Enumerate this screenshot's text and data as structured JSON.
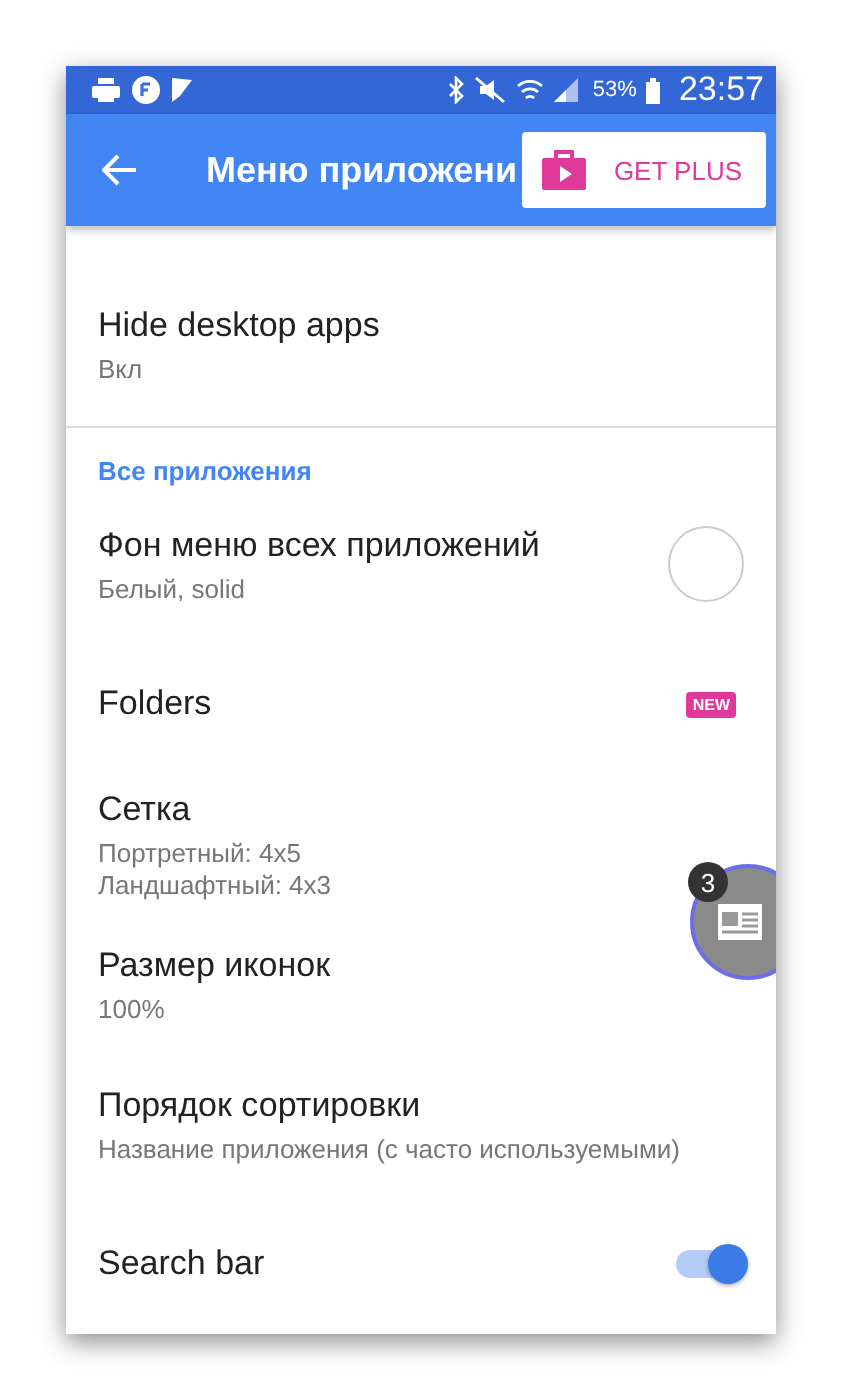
{
  "status_bar": {
    "battery": "53%",
    "time": "23:57"
  },
  "app_bar": {
    "title": "Меню приложени",
    "plus_button": "GET PLUS"
  },
  "rows": [
    {
      "kind": "text",
      "title": "Hide desktop apps",
      "subtitle": [
        "Вкл"
      ]
    },
    {
      "kind": "section",
      "title": "Все приложения"
    },
    {
      "kind": "color",
      "title": "Фон меню всех приложений",
      "subtitle": [
        "Белый, solid"
      ],
      "color": "#ffffff"
    },
    {
      "kind": "badge",
      "title": "Folders",
      "badge": "NEW"
    },
    {
      "kind": "text",
      "title": "Сетка",
      "subtitle": [
        "Портретный: 4x5",
        "Ландшафтный: 4x3"
      ]
    },
    {
      "kind": "text",
      "title": "Размер иконок",
      "subtitle": [
        "100%"
      ]
    },
    {
      "kind": "text",
      "title": "Порядок сортировки",
      "subtitle": [
        "Название приложения (с часто используемыми)"
      ]
    },
    {
      "kind": "switch",
      "title": "Search bar",
      "on": true
    }
  ],
  "bubble": {
    "count": "3"
  }
}
